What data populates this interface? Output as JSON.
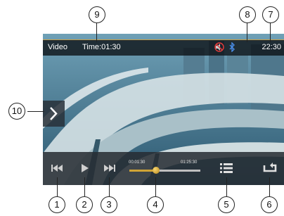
{
  "status_bar": {
    "source_title": "Video",
    "elapsed_label": "Time:01:30",
    "clock": "22:30",
    "icons": [
      "mute-icon",
      "bluetooth-icon"
    ]
  },
  "controls": {
    "icons": [
      "previous-icon",
      "play-icon",
      "next-icon",
      "playlist-icon",
      "repeat-icon",
      "next-tab-icon"
    ]
  },
  "progress": {
    "current_time": "00:01:30",
    "total_time": "01:25:30",
    "fraction": 0.38
  },
  "callouts": [
    "1",
    "2",
    "3",
    "4",
    "5",
    "6",
    "7",
    "8",
    "9",
    "10"
  ],
  "colors": {
    "accent": "#d0a436",
    "bar_bg": "#262c32"
  }
}
